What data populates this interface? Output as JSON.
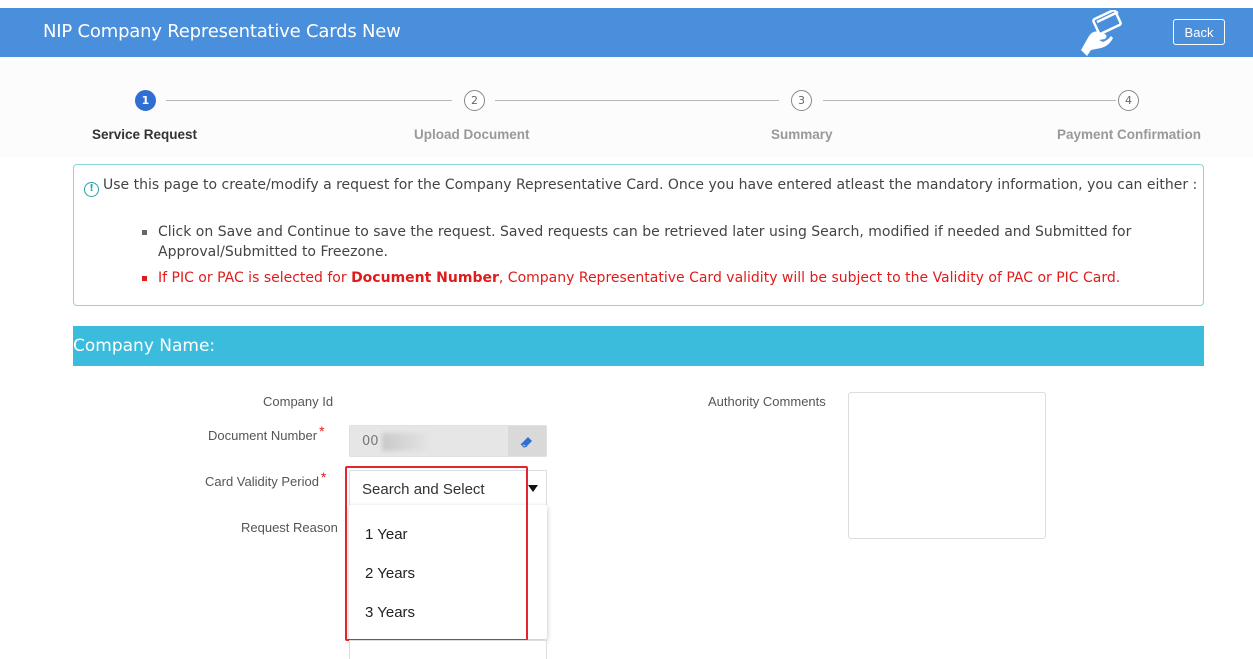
{
  "header": {
    "title": "NIP Company Representative Cards New",
    "back_label": "Back",
    "color": "#4a8fdb"
  },
  "stepper": {
    "steps": [
      {
        "number": "1",
        "label": "Service Request",
        "active": true
      },
      {
        "number": "2",
        "label": "Upload Document",
        "active": false
      },
      {
        "number": "3",
        "label": "Summary",
        "active": false
      },
      {
        "number": "4",
        "label": "Payment Confirmation",
        "active": false
      }
    ]
  },
  "info": {
    "intro": "Use this page to create/modify a request for the Company Representative Card. Once you have entered atleast the mandatory information, you can either :",
    "bullet_1": "Click on Save and Continue to save the request. Saved requests can be retrieved later using Search, modified if needed and Submitted for Approval/Submitted to Freezone.",
    "bullet_2_pre": "If PIC or PAC is selected for ",
    "bullet_2_bold": "Document Number",
    "bullet_2_post": ", Company Representative Card validity will be subject to the Validity of PAC or PIC Card.",
    "warn_color": "#e01b1b"
  },
  "section": {
    "title": "Company Name:",
    "color": "#3cbcdc"
  },
  "form": {
    "company_id_label": "Company Id",
    "document_number_label": "Document Number",
    "document_number_value": "00",
    "card_validity_label": "Card Validity Period",
    "card_validity_value": "Search and Select",
    "card_validity_options": [
      "1 Year",
      "2 Years",
      "3 Years"
    ],
    "request_reason_label": "Request Reason",
    "authority_comments_label": "Authority Comments",
    "required_mark": "*"
  }
}
